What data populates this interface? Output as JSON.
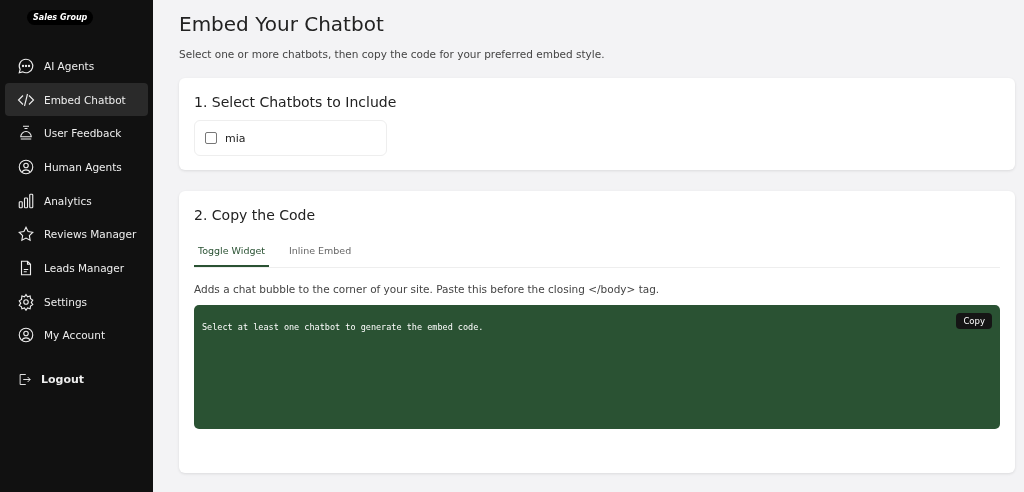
{
  "logo": "Sales Group",
  "sidebar": {
    "items": [
      {
        "label": "AI Agents",
        "kind": "chat",
        "selected": false
      },
      {
        "label": "Embed Chatbot",
        "kind": "code",
        "selected": true
      },
      {
        "label": "User Feedback",
        "kind": "feedback",
        "selected": false
      },
      {
        "label": "Human Agents",
        "kind": "user",
        "selected": false
      },
      {
        "label": "Analytics",
        "kind": "bars",
        "selected": false
      },
      {
        "label": "Reviews Manager",
        "kind": "star",
        "selected": false
      },
      {
        "label": "Leads Manager",
        "kind": "doc",
        "selected": false
      },
      {
        "label": "Settings",
        "kind": "gear",
        "selected": false
      },
      {
        "label": "My Account",
        "kind": "user",
        "selected": false
      }
    ],
    "logout": "Logout"
  },
  "page": {
    "title": "Embed Your Chatbot",
    "subtitle": "Select one or more chatbots, then copy the code for your preferred embed style."
  },
  "select_card": {
    "title": "1. Select Chatbots to Include",
    "chatbots": [
      {
        "name": "mia",
        "checked": false
      }
    ]
  },
  "code_card": {
    "title": "2. Copy the Code",
    "tabs": [
      {
        "label": "Toggle Widget",
        "selected": true
      },
      {
        "label": "Inline Embed",
        "selected": false
      }
    ],
    "description": "Adds a chat bubble to the corner of your site. Paste this before the closing </body> tag.",
    "code": "Select at least one chatbot to generate the embed code.",
    "copy_button": "Copy"
  }
}
